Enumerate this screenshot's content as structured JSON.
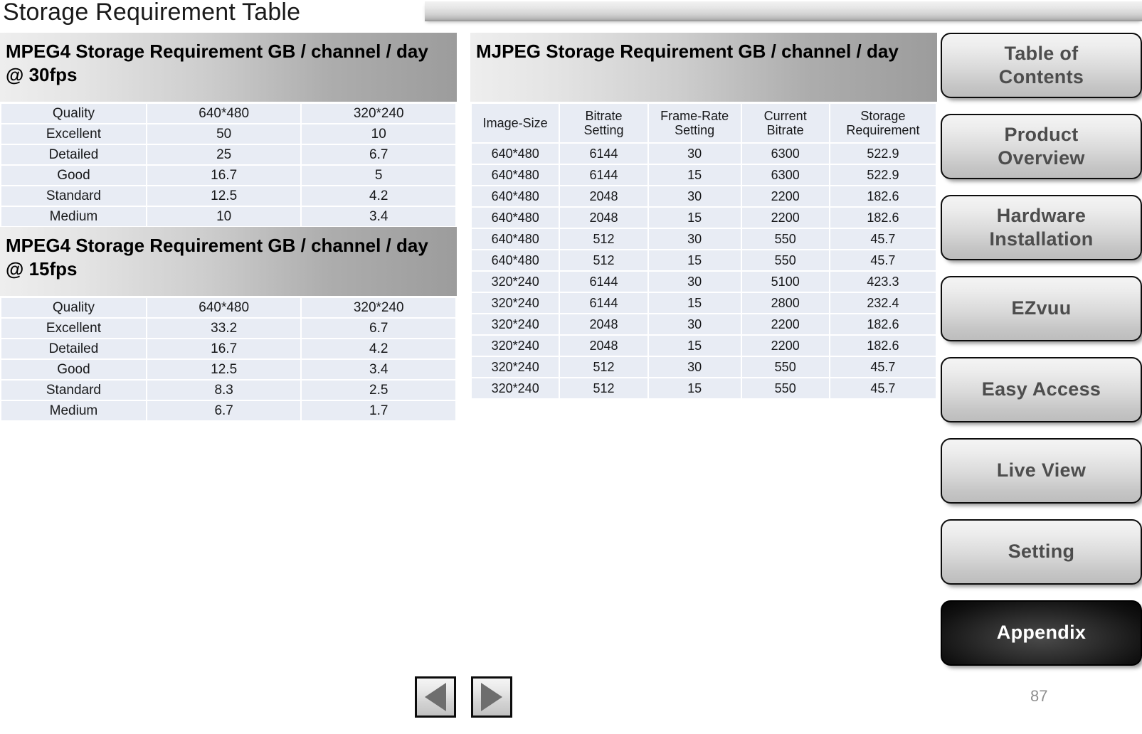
{
  "slide": {
    "title": "Storage Requirement Table",
    "page_number": "87"
  },
  "tables": {
    "mpeg4_30": {
      "heading": "MPEG4 Storage Requirement GB / channel / day @ 30fps",
      "headers": [
        "Quality",
        "640*480",
        "320*240"
      ],
      "rows": [
        [
          "Excellent",
          "50",
          "10"
        ],
        [
          "Detailed",
          "25",
          "6.7"
        ],
        [
          "Good",
          "16.7",
          "5"
        ],
        [
          "Standard",
          "12.5",
          "4.2"
        ],
        [
          "Medium",
          "10",
          "3.4"
        ]
      ]
    },
    "mpeg4_15": {
      "heading": "MPEG4 Storage Requirement GB / channel / day @ 15fps",
      "headers": [
        "Quality",
        "640*480",
        "320*240"
      ],
      "rows": [
        [
          "Excellent",
          "33.2",
          "6.7"
        ],
        [
          "Detailed",
          "16.7",
          "4.2"
        ],
        [
          "Good",
          "12.5",
          "3.4"
        ],
        [
          "Standard",
          "8.3",
          "2.5"
        ],
        [
          "Medium",
          "6.7",
          "1.7"
        ]
      ]
    },
    "mjpeg": {
      "heading": "MJPEG Storage Requirement GB / channel / day",
      "headers": [
        "Image-Size",
        "Bitrate\nSetting",
        "Frame-Rate\nSetting",
        "Current\nBitrate",
        "Storage\nRequirement"
      ],
      "rows": [
        [
          "640*480",
          "6144",
          "30",
          "6300",
          "522.9"
        ],
        [
          "640*480",
          "6144",
          "15",
          "6300",
          "522.9"
        ],
        [
          "640*480",
          "2048",
          "30",
          "2200",
          "182.6"
        ],
        [
          "640*480",
          "2048",
          "15",
          "2200",
          "182.6"
        ],
        [
          "640*480",
          "512",
          "30",
          "550",
          "45.7"
        ],
        [
          "640*480",
          "512",
          "15",
          "550",
          "45.7"
        ],
        [
          "320*240",
          "6144",
          "30",
          "5100",
          "423.3"
        ],
        [
          "320*240",
          "6144",
          "15",
          "2800",
          "232.4"
        ],
        [
          "320*240",
          "2048",
          "30",
          "2200",
          "182.6"
        ],
        [
          "320*240",
          "2048",
          "15",
          "2200",
          "182.6"
        ],
        [
          "320*240",
          "512",
          "30",
          "550",
          "45.7"
        ],
        [
          "320*240",
          "512",
          "15",
          "550",
          "45.7"
        ]
      ]
    }
  },
  "nav": {
    "buttons": [
      {
        "label": "Table of\nContents",
        "active": false
      },
      {
        "label": "Product\nOverview",
        "active": false
      },
      {
        "label": "Hardware\nInstallation",
        "active": false
      },
      {
        "label": "EZvuu",
        "active": false
      },
      {
        "label": "Easy Access",
        "active": false
      },
      {
        "label": "Live View",
        "active": false
      },
      {
        "label": "Setting",
        "active": false
      },
      {
        "label": "Appendix",
        "active": true
      }
    ]
  },
  "footer": {
    "prev_icon": "triangle-left-icon",
    "next_icon": "triangle-right-icon"
  },
  "colors": {
    "cell_bg": "#e8ecf4",
    "active_button_bg": "#111111",
    "page_number": "#8e8e8e"
  }
}
